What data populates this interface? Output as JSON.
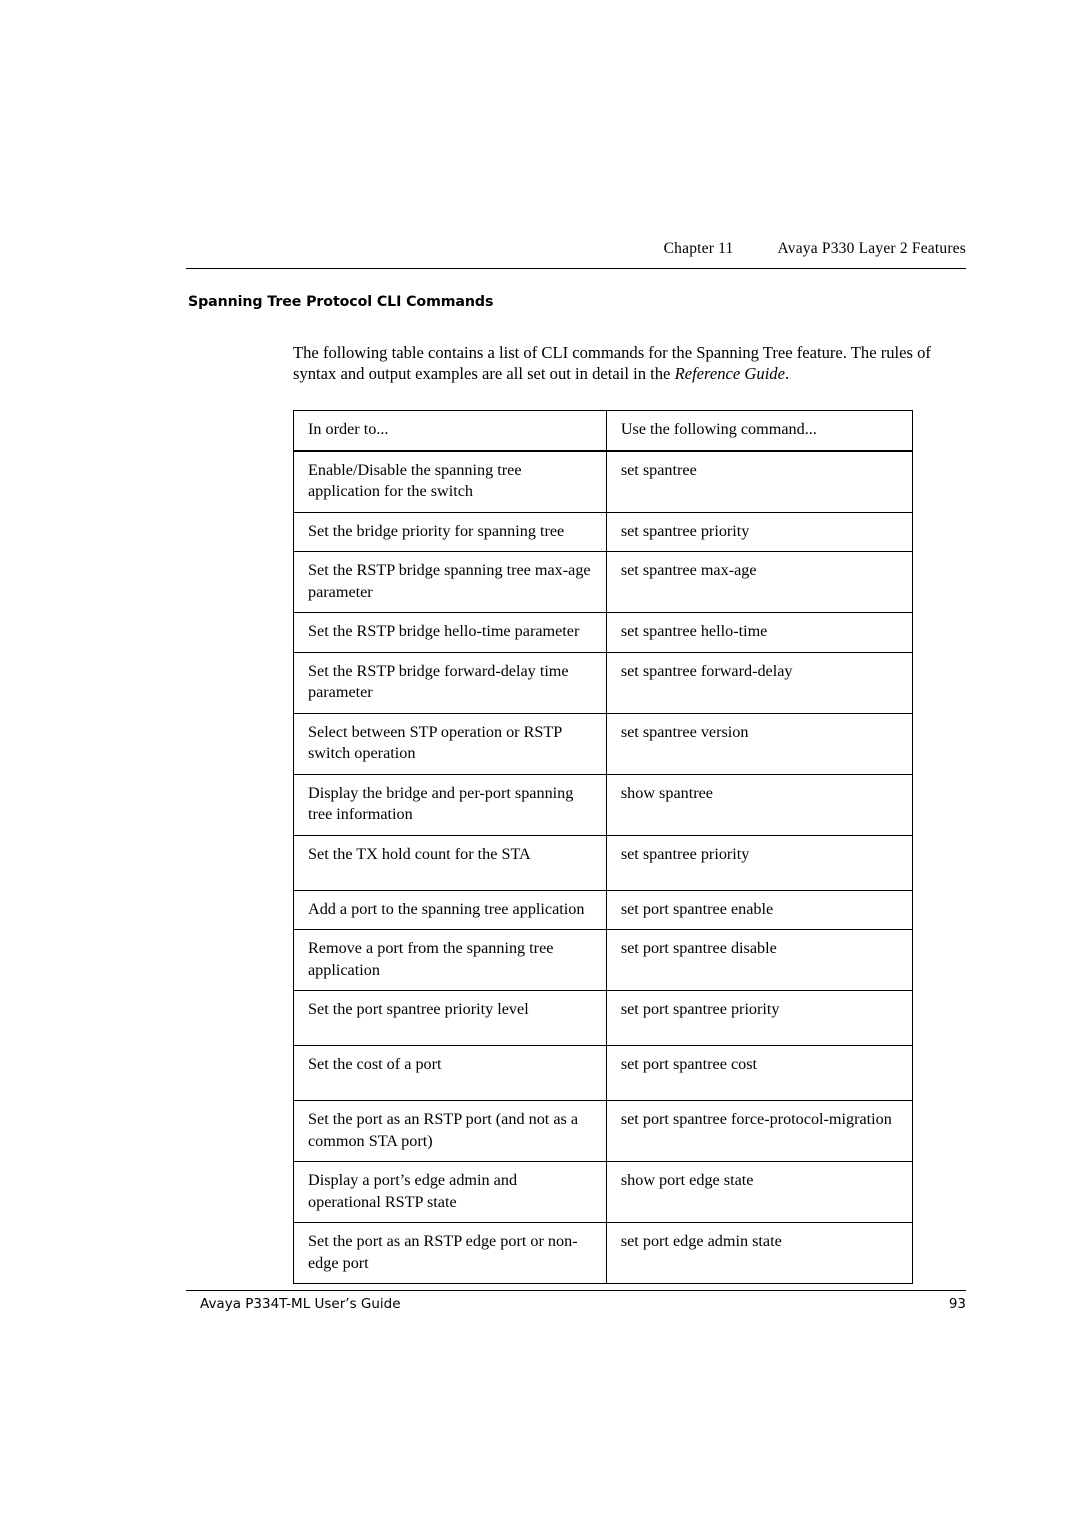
{
  "header": {
    "chapter": "Chapter 11",
    "title": "Avaya P330 Layer 2 Features"
  },
  "section": {
    "title": "Spanning Tree Protocol CLI Commands",
    "intro_part1": "The following table contains a list of CLI commands for the Spanning Tree feature. The rules of syntax and output examples are all set out in detail in the ",
    "intro_italic": "Reference Guide",
    "intro_part2": "."
  },
  "table": {
    "headers": [
      "In order to...",
      "Use the following command..."
    ],
    "rows": [
      [
        "Enable/Disable the spanning tree application for the switch",
        "set spantree"
      ],
      [
        "Set the bridge priority for spanning tree",
        "set spantree priority"
      ],
      [
        "Set the RSTP bridge spanning tree max-age parameter",
        "set spantree max-age"
      ],
      [
        "Set the RSTP bridge hello-time parameter",
        "set spantree hello-time"
      ],
      [
        "Set the RSTP bridge forward-delay time parameter",
        "set spantree forward-delay"
      ],
      [
        "Select between STP operation or RSTP switch operation",
        "set spantree version"
      ],
      [
        "Display the bridge and per-port spanning tree information",
        "show spantree"
      ],
      [
        "Set the TX hold count for the STA",
        "set spantree priority"
      ],
      [
        "Add a port to the spanning tree application",
        "set port spantree enable"
      ],
      [
        "Remove a port from the spanning tree application",
        "set port spantree disable"
      ],
      [
        "Set the port spantree priority level",
        "set port spantree priority"
      ],
      [
        "Set the cost of a port",
        "set port spantree cost"
      ],
      [
        "Set the port as an RSTP port (and not as a common STA port)",
        "set port spantree force-protocol-migration"
      ],
      [
        "Display a port’s edge admin and operational RSTP state",
        "show port edge state"
      ],
      [
        "Set the port as an RSTP edge port or non-edge port",
        "set port edge admin state"
      ]
    ]
  },
  "footer": {
    "document": "Avaya P334T-ML User’s Guide",
    "page_number": "93"
  }
}
